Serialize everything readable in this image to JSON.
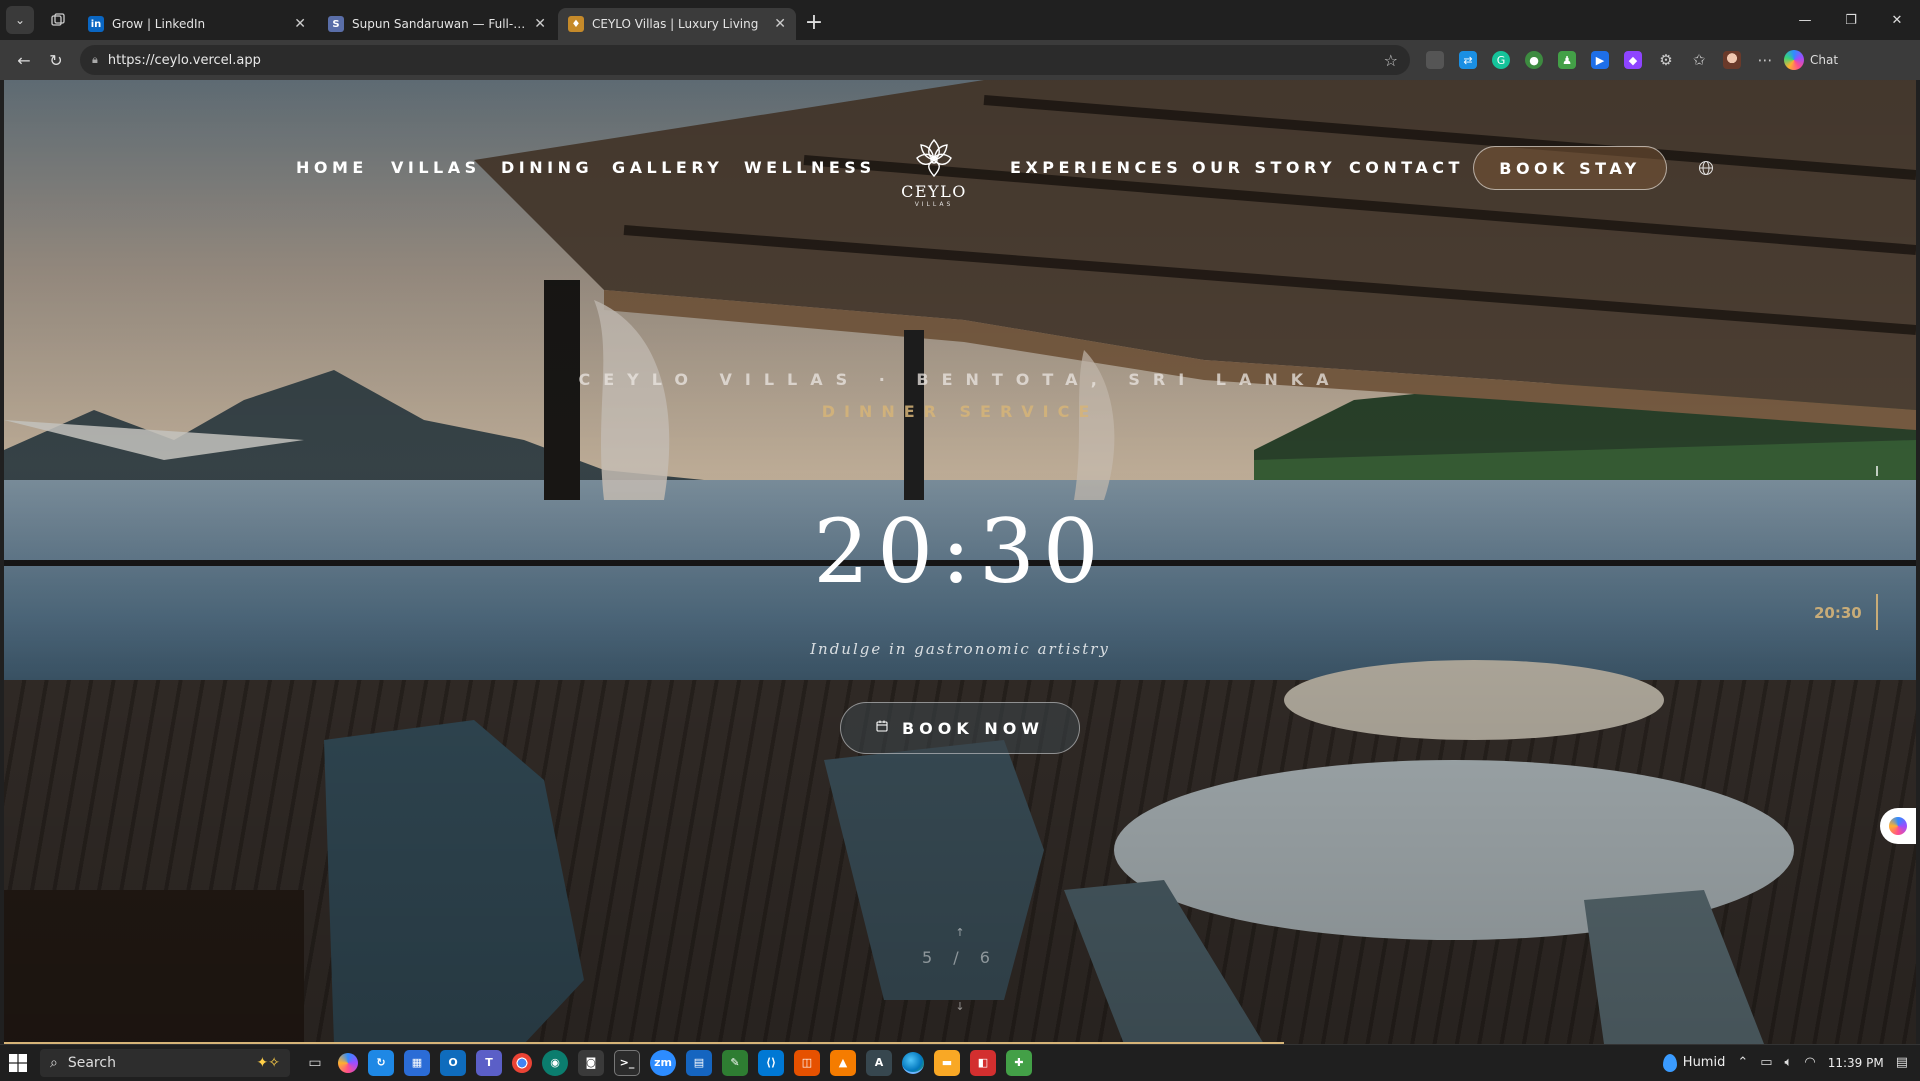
{
  "browser": {
    "tabs": [
      {
        "title": "Grow | LinkedIn",
        "favicon": "linkedin-icon",
        "color": "#0a66c2",
        "glyph": "in",
        "active": false
      },
      {
        "title": "Supun Sandaruwan — Full-Stack D",
        "favicon": "portfolio-icon",
        "color": "#5a6ea8",
        "glyph": "S",
        "active": false
      },
      {
        "title": "CEYLO Villas | Luxury Living",
        "favicon": "ceylo-icon",
        "color": "#c58a2a",
        "glyph": "♦",
        "active": true
      }
    ],
    "url": "https://ceylo.vercel.app",
    "chat_label": "Chat"
  },
  "site": {
    "nav_left": [
      "HOME",
      "VILLAS",
      "DINING",
      "GALLERY",
      "WELLNESS"
    ],
    "nav_right": [
      "EXPERIENCES",
      "OUR STORY",
      "CONTACT"
    ],
    "logo_name": "CEYLO",
    "logo_sub": "VILLAS",
    "book_stay": "BOOK STAY"
  },
  "hero": {
    "eyebrow": "CEYLO VILLAS · BENTOTA, SRI LANKA",
    "subtitle": "DINNER SERVICE",
    "time": "20:30",
    "tagline": "Indulge in gastronomic artistry",
    "cta": "BOOK NOW",
    "slide_current": "5",
    "slide_total": "6",
    "pager": "5 / 6",
    "side_time": "20:30"
  },
  "taskbar": {
    "search_placeholder": "Search",
    "weather": "Humid",
    "time": "11:39 PM"
  },
  "colors": {
    "accent_gold": "#d6b478",
    "browser_dark": "#202020",
    "browser_toolbar": "#3b3b3b"
  }
}
